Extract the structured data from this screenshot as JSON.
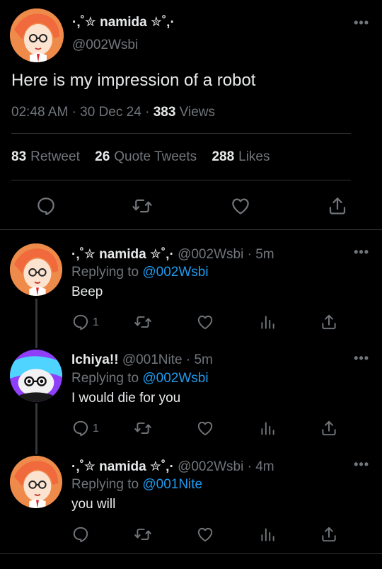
{
  "main_tweet": {
    "display_name": "·‚˚✮ namida ✮˚‚·",
    "handle": "@002Wsbi",
    "text": "Here is my impression of a robot",
    "time": "02:48 AM",
    "date": "30 Dec 24",
    "views_count": "383",
    "views_label": "Views",
    "retweets_count": "83",
    "retweets_label": "Retweet",
    "quotes_count": "26",
    "quotes_label": "Quote Tweets",
    "likes_count": "288",
    "likes_label": "Likes",
    "icons": [
      "reply-icon",
      "retweet-icon",
      "like-icon",
      "share-icon"
    ]
  },
  "replies": [
    {
      "display_name": "·‚˚✮ namida ✮˚‚·",
      "handle": "@002Wsbi",
      "time": "5m",
      "replying_prefix": "Replying to",
      "replying_to": "@002Wsbi",
      "text": "Beep",
      "reply_count": "1"
    },
    {
      "display_name": "Ichiya!!",
      "handle": "@001Nite",
      "time": "5m",
      "replying_prefix": "Replying to",
      "replying_to": "@002Wsbi",
      "text": "I would die for you",
      "reply_count": "1"
    },
    {
      "display_name": "·‚˚✮ namida ✮˚‚·",
      "handle": "@002Wsbi",
      "time": "4m",
      "replying_prefix": "Replying to",
      "replying_to": "@001Nite",
      "text": "you will",
      "reply_count": ""
    }
  ],
  "separator": "·",
  "more_icon": "more-icon",
  "colors": {
    "background": "#000000",
    "text": "#e7e9ea",
    "muted": "#71767b",
    "link": "#1d9bf0",
    "divider": "#2f3336"
  }
}
